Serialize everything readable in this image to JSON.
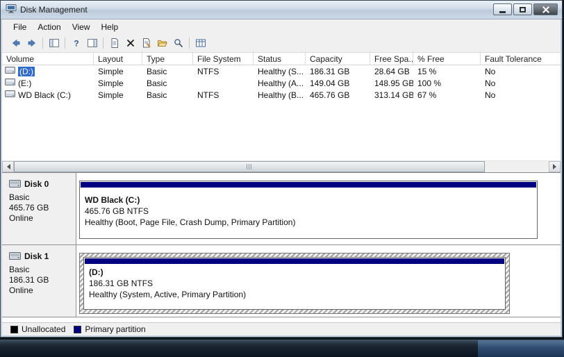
{
  "window": {
    "title": "Disk Management",
    "controls": [
      "minimize",
      "maximize",
      "close"
    ]
  },
  "menu": {
    "items": [
      "File",
      "Action",
      "View",
      "Help"
    ]
  },
  "toolbar": {
    "icons": [
      "back",
      "forward",
      "show-console-tree",
      "help",
      "show-action-pane",
      "document",
      "delete",
      "document-edit",
      "folder-open",
      "magnifier",
      "grid-views"
    ],
    "help_glyph": "?"
  },
  "volume_table": {
    "columns": [
      "Volume",
      "Layout",
      "Type",
      "File System",
      "Status",
      "Capacity",
      "Free Spa...",
      "% Free",
      "Fault Tolerance"
    ],
    "rows": [
      {
        "volume": "(D:)",
        "layout": "Simple",
        "type": "Basic",
        "file_system": "NTFS",
        "status": "Healthy (S...",
        "capacity": "186.31 GB",
        "free_space": "28.64 GB",
        "pct_free": "15 %",
        "fault_tolerance": "No",
        "selected": true
      },
      {
        "volume": "(E:)",
        "layout": "Simple",
        "type": "Basic",
        "file_system": "",
        "status": "Healthy (A...",
        "capacity": "149.04 GB",
        "free_space": "148.95 GB",
        "pct_free": "100 %",
        "fault_tolerance": "No",
        "selected": false
      },
      {
        "volume": "WD Black (C:)",
        "layout": "Simple",
        "type": "Basic",
        "file_system": "NTFS",
        "status": "Healthy (B...",
        "capacity": "465.76 GB",
        "free_space": "313.14 GB",
        "pct_free": "67 %",
        "fault_tolerance": "No",
        "selected": false
      }
    ]
  },
  "disks": [
    {
      "name": "Disk 0",
      "type": "Basic",
      "size": "465.76 GB",
      "status": "Online",
      "partition": {
        "title": "WD Black  (C:)",
        "size_fs": "465.76 GB NTFS",
        "health": "Healthy (Boot, Page File, Crash Dump, Primary Partition)",
        "color": "#000080",
        "selected": false
      }
    },
    {
      "name": "Disk 1",
      "type": "Basic",
      "size": "186.31 GB",
      "status": "Online",
      "partition": {
        "title": "(D:)",
        "size_fs": "186.31 GB NTFS",
        "health": "Healthy (System, Active, Primary Partition)",
        "color": "#000080",
        "selected": true
      }
    }
  ],
  "legend": {
    "items": [
      {
        "label": "Unallocated",
        "color": "#000000"
      },
      {
        "label": "Primary partition",
        "color": "#000080"
      }
    ]
  },
  "colors": {
    "selection": "#2e6bcd",
    "primary_partition": "#000080",
    "unallocated": "#000000"
  }
}
